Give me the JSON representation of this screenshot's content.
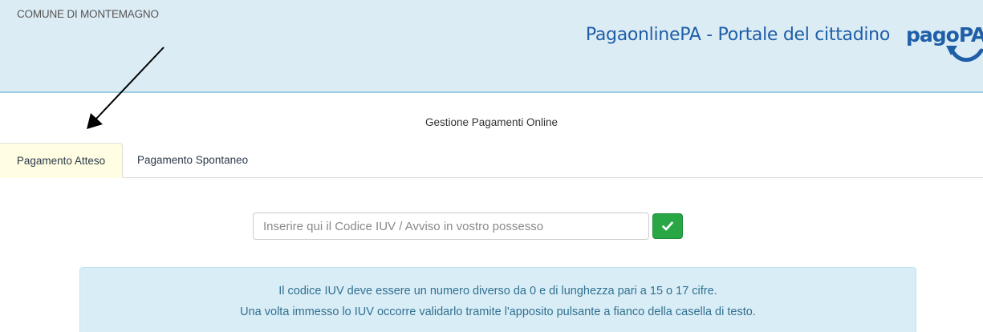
{
  "header": {
    "municipality": "COMUNE DI MONTEMAGNO",
    "portal_title": "PagaonlinePA - Portale del cittadino",
    "logo_text": "pagoPA",
    "logo_color": "#1f5fa8",
    "background_color": "#dcecf4"
  },
  "section_title": "Gestione Pagamenti Online",
  "tabs": [
    {
      "label": "Pagamento Atteso",
      "active": true
    },
    {
      "label": "Pagamento Spontaneo",
      "active": false
    }
  ],
  "search": {
    "value": "",
    "placeholder": "Inserire qui il Codice IUV / Avviso in vostro possesso",
    "confirm_icon": "check-icon",
    "confirm_color": "#29a745"
  },
  "info": {
    "line1": "Il codice IUV deve essere un numero diverso da 0 e di lunghezza pari a 15 o 17 cifre.",
    "line2": "Una volta immesso lo IUV occorre validarlo tramite l'apposito pulsante a fianco della casella di testo.",
    "background_color": "#d9edf7",
    "text_color": "#31708f"
  },
  "annotation": {
    "icon": "arrow-annotation-icon"
  }
}
